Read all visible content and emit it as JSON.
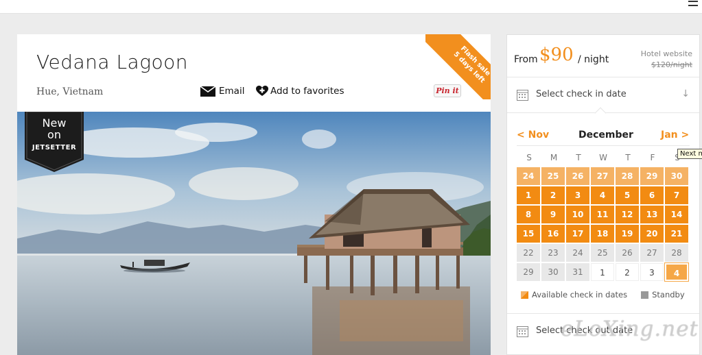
{
  "listing": {
    "name": "Vedana Lagoon",
    "location": "Hue, Vietnam",
    "email_label": "Email",
    "favorites_label": "Add to favorites",
    "pin_label": "Pin it",
    "flash_sale": "Flash sale",
    "days_left": "5 days left",
    "badge_line1": "New",
    "badge_line2": "on",
    "badge_brand": "JETSETTER"
  },
  "booking": {
    "from_label": "From",
    "price": "$90",
    "per_night": "/ night",
    "hotel_website_label": "Hotel website",
    "hotel_website_price": "$120/night",
    "checkin_label": "Select check in date",
    "checkout_label": "Select check out date"
  },
  "calendar": {
    "prev_label": "< Nov",
    "month": "December",
    "next_label": "Jan >",
    "tooltip": "Next m",
    "weekdays": [
      "S",
      "M",
      "T",
      "W",
      "T",
      "F",
      "S"
    ],
    "legend_available": "Available check in dates",
    "legend_standby": "Standby",
    "days": [
      {
        "d": "24",
        "s": "past"
      },
      {
        "d": "25",
        "s": "past"
      },
      {
        "d": "26",
        "s": "past"
      },
      {
        "d": "27",
        "s": "past"
      },
      {
        "d": "28",
        "s": "past"
      },
      {
        "d": "29",
        "s": "past"
      },
      {
        "d": "30",
        "s": "past"
      },
      {
        "d": "1",
        "s": "avail"
      },
      {
        "d": "2",
        "s": "avail"
      },
      {
        "d": "3",
        "s": "avail"
      },
      {
        "d": "4",
        "s": "avail"
      },
      {
        "d": "5",
        "s": "avail"
      },
      {
        "d": "6",
        "s": "avail"
      },
      {
        "d": "7",
        "s": "avail"
      },
      {
        "d": "8",
        "s": "avail"
      },
      {
        "d": "9",
        "s": "avail"
      },
      {
        "d": "10",
        "s": "avail"
      },
      {
        "d": "11",
        "s": "avail"
      },
      {
        "d": "12",
        "s": "avail"
      },
      {
        "d": "13",
        "s": "avail"
      },
      {
        "d": "14",
        "s": "avail"
      },
      {
        "d": "15",
        "s": "avail"
      },
      {
        "d": "16",
        "s": "avail"
      },
      {
        "d": "17",
        "s": "avail"
      },
      {
        "d": "18",
        "s": "avail"
      },
      {
        "d": "19",
        "s": "avail"
      },
      {
        "d": "20",
        "s": "avail"
      },
      {
        "d": "21",
        "s": "avail"
      },
      {
        "d": "22",
        "s": "standby"
      },
      {
        "d": "23",
        "s": "standby"
      },
      {
        "d": "24",
        "s": "standby"
      },
      {
        "d": "25",
        "s": "standby"
      },
      {
        "d": "26",
        "s": "standby"
      },
      {
        "d": "27",
        "s": "standby"
      },
      {
        "d": "28",
        "s": "standby"
      },
      {
        "d": "29",
        "s": "standby"
      },
      {
        "d": "30",
        "s": "standby"
      },
      {
        "d": "31",
        "s": "standby"
      },
      {
        "d": "1",
        "s": "empty"
      },
      {
        "d": "2",
        "s": "empty"
      },
      {
        "d": "3",
        "s": "empty"
      },
      {
        "d": "4",
        "s": "sel"
      }
    ]
  },
  "colors": {
    "accent": "#f28b12",
    "past": "#f5b264",
    "standby": "#e8e8e8"
  },
  "watermark": "eLoXing.net"
}
